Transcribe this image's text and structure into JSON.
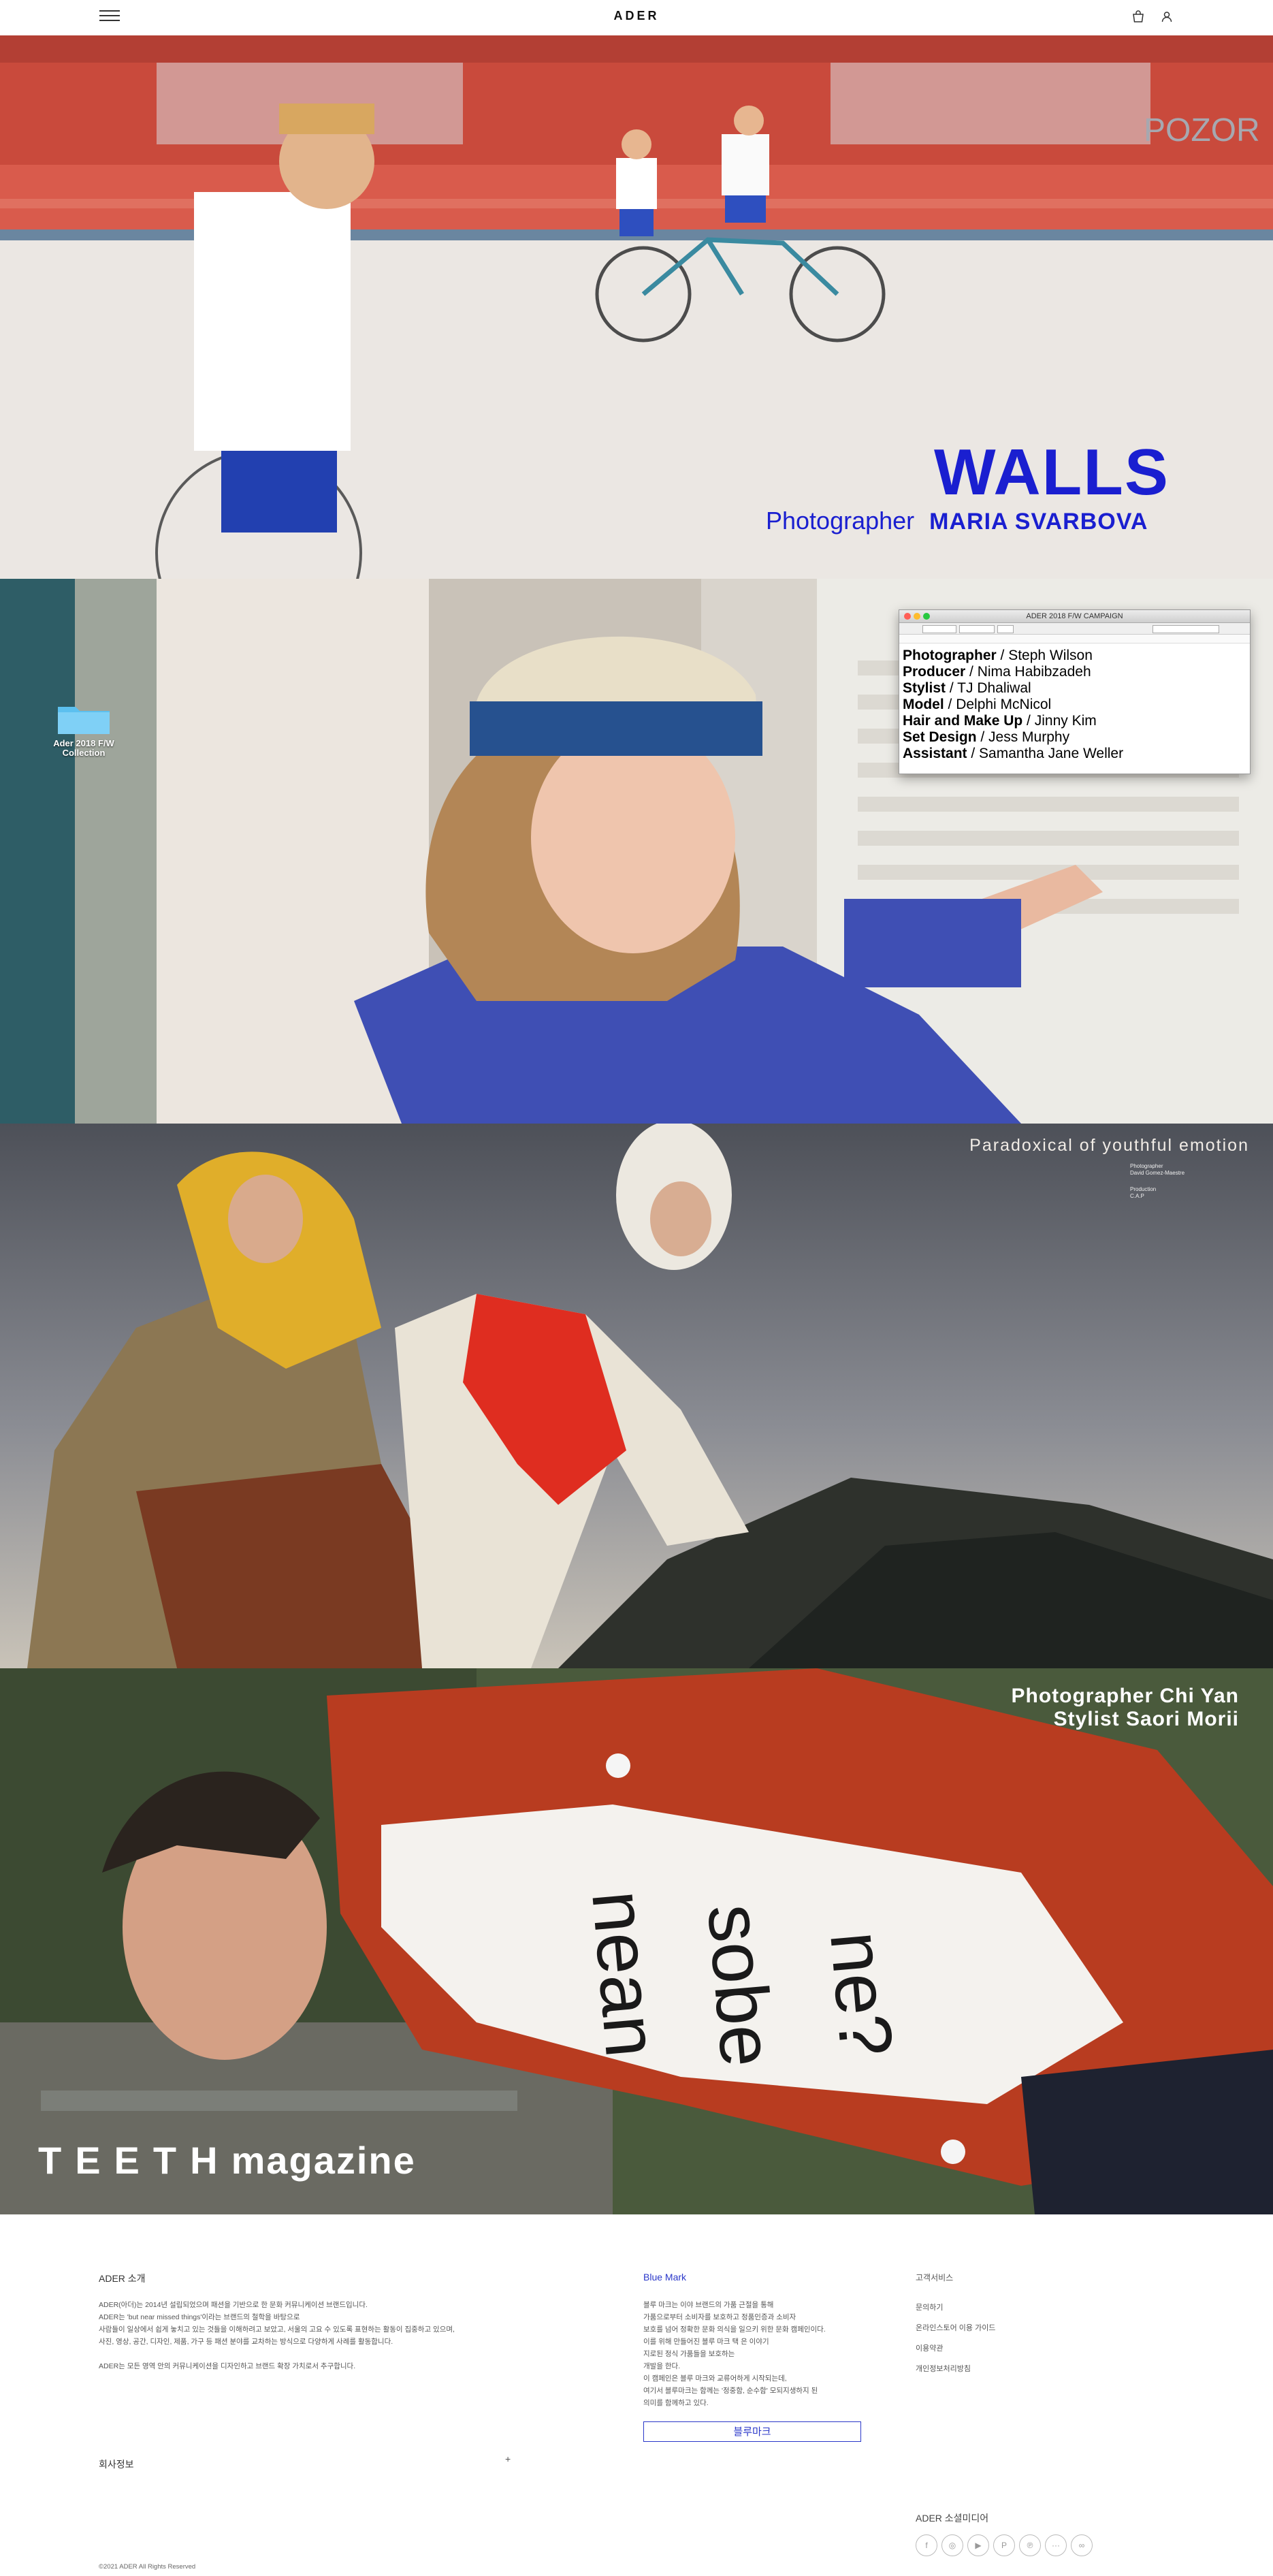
{
  "header": {
    "logo": "ADER",
    "menu_icon": "hamburger-menu-icon",
    "cart_icon": "shopping-bag-icon",
    "user_icon": "user-icon"
  },
  "campaigns": [
    {
      "title": "WALLS",
      "credit_role": "Photographer",
      "credit_name": "MARIA SVARBOVA",
      "accent": "#1a1fd0"
    },
    {
      "folder_label": "Ader 2018 F/W Collection",
      "window_title": "ADER 2018 F/W CAMPAIGN",
      "credits": [
        {
          "role": "Photographer",
          "name": "Steph Wilson"
        },
        {
          "role": "Producer",
          "name": "Nima Habibzadeh"
        },
        {
          "role": "Stylist",
          "name": "TJ Dhaliwal"
        },
        {
          "role": "Model",
          "name": "Delphi McNicol"
        },
        {
          "role": "Hair and Make Up",
          "name": "Jinny Kim"
        },
        {
          "role": "Set Design",
          "name": "Jess Murphy"
        },
        {
          "role": "Assistant",
          "name": "Samantha Jane Weller"
        }
      ]
    },
    {
      "title": "Paradoxical of youthful emotion",
      "small_1_label": "Photographer",
      "small_1_value": "David Gomez-Maestre",
      "small_2_label": "Production",
      "small_2_value": "C.A.P"
    },
    {
      "credit_line_1": "Photographer Chi Yan",
      "credit_line_2": "Stylist Saori Morii",
      "magazine_word_1": "TEETH",
      "magazine_word_2": "magazine"
    }
  ],
  "footer": {
    "about": {
      "title": "ADER 소개",
      "lines": [
        "ADER(아더)는 2014년 설립되었으며 패션을 기반으로 한 문화 커뮤니케이션 브랜드입니다.",
        "ADER는 'but near missed things'이라는 브랜드의 철학을 바탕으로",
        "사람들이 일상에서 쉽게 놓치고 있는 것들을 이해하려고 보았고, 서울의 고요 수 있도록 표현하는 활동이 집중하고 있으며,",
        "사진, 영상, 공간, 디자인, 제품, 가구 등 패션 분야를 교차하는 방식으로 다양하게 사례를 활동합니다.",
        "",
        "ADER는 모든 영역 안의 커뮤니케이션을 디자인하고 브랜드 확장 가치로서 추구합니다."
      ]
    },
    "bluemark": {
      "title": "Blue Mark",
      "lines": [
        "블루 마크는 이야 브랜드의 가품 근절을 통해",
        "가품으로부터 소비자를 보호하고 정품인증과 소비자",
        "보호를 넘어 정확한 문화 의식을 일으키 위한 문화 캠페인이다.",
        "이를 위해 만들어진 블루 마크 택 은 이야기",
        "지로된 정식 가품들을 보호하는",
        "개발을 한다.",
        "이 캠페인은 블루 마크와 교류어하게 시작되는데,",
        "여기서 블루마크는 함께는 '정중함, 순수함' 모되지생하지 된",
        "의미를 함께하고 있다."
      ],
      "button_label": "블루마크"
    },
    "customer_service": {
      "title": "고객서비스",
      "links": [
        "문의하기",
        "온라인스토어 이용 가이드",
        "이용약관",
        "개인정보처리방침"
      ]
    },
    "company_info_label": "회사정보",
    "company_info_toggle": "+",
    "social": {
      "title": "ADER 소셜미디어",
      "icons": [
        {
          "name": "facebook-icon",
          "glyph": "f"
        },
        {
          "name": "instagram-icon",
          "glyph": "◎"
        },
        {
          "name": "youtube-icon",
          "glyph": "▶"
        },
        {
          "name": "pinterest-icon",
          "glyph": "P"
        },
        {
          "name": "pinterest-alt-icon",
          "glyph": "℗"
        },
        {
          "name": "kakao-icon",
          "glyph": "···"
        },
        {
          "name": "weibo-icon",
          "glyph": "∞"
        }
      ]
    },
    "copyright": "©2021 ADER All Rights Reserved"
  }
}
